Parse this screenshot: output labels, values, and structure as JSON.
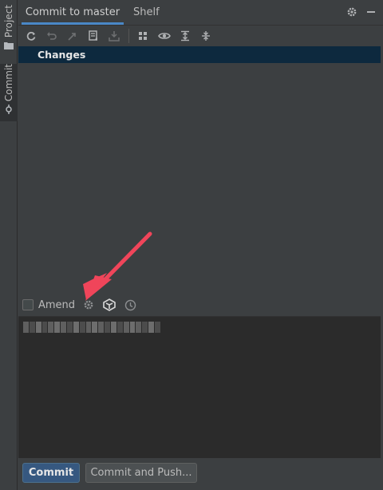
{
  "side_tabs": [
    {
      "label": "Project",
      "icon": "folder-icon"
    },
    {
      "label": "Commit",
      "icon": "commit-icon"
    }
  ],
  "header": {
    "tabs": [
      {
        "label": "Commit to master",
        "active": true
      },
      {
        "label": "Shelf",
        "active": false
      }
    ],
    "icons": [
      "gear-icon",
      "minimize-icon"
    ]
  },
  "toolbar": {
    "icons": [
      "refresh-icon",
      "rollback-icon",
      "move-to-changelist-icon",
      "diff-icon",
      "shelve-icon",
      "group-by-icon",
      "show-icon",
      "expand-all-icon",
      "collapse-all-icon"
    ]
  },
  "tree": {
    "root_label": "Changes"
  },
  "options": {
    "amend_label": "Amend",
    "amend_checked": false,
    "icons": [
      "commit-options-gear-icon",
      "github-copilot-icon",
      "history-icon"
    ]
  },
  "message": {
    "text": "",
    "blurred": true
  },
  "buttons": {
    "commit_label": "Commit",
    "commit_push_label": "Commit and Push..."
  },
  "colors": {
    "accent": "#4a88c7",
    "selection": "#0d293e",
    "primary_button": "#365880",
    "annotation_arrow": "#f0455a"
  }
}
